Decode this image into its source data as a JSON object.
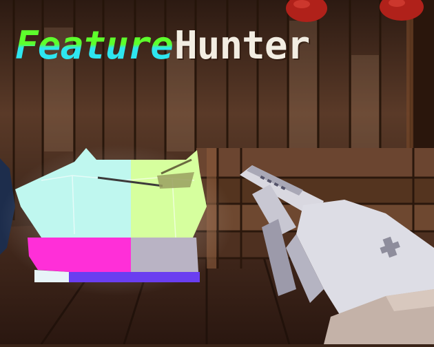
{
  "title": {
    "word1": "Feature",
    "word2": "Hunter"
  },
  "colors": {
    "word1_top": "#5dff2c",
    "word1_bottom": "#2ee6f0",
    "word2": "#f2ede2",
    "cube_cyan": "#bff7ef",
    "cube_green": "#d6ff9e",
    "cube_magenta": "#ff2fd8",
    "cube_grey": "#b9b3c4",
    "cube_violet": "#6a3ef0",
    "wood_dark": "#3b2418",
    "wood_light": "#7a5038",
    "gun_body": "#d9d8e0",
    "gun_dark": "#a9a8b6",
    "gun_stock": "#c4b2a8"
  },
  "icons": [
    "berry-icon",
    "berry-icon"
  ]
}
